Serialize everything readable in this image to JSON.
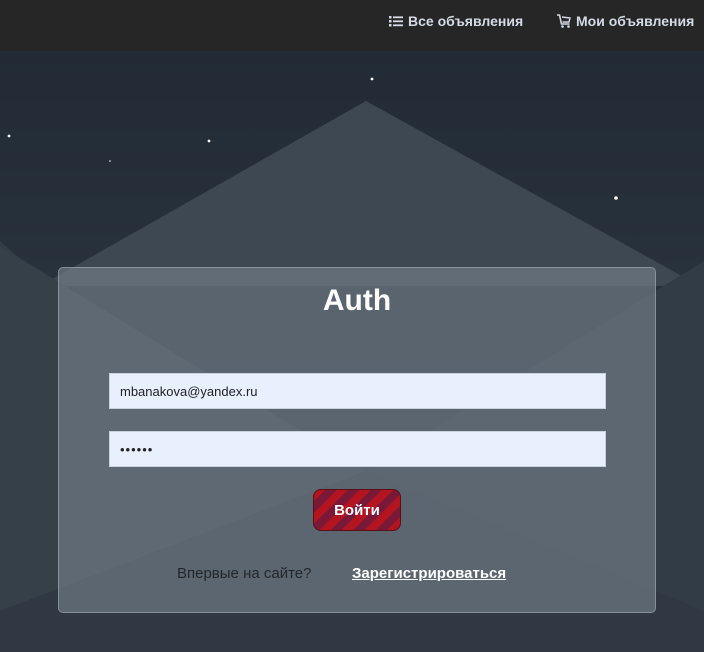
{
  "nav": {
    "all_ads": {
      "label": "Все объявления",
      "icon": "list-icon"
    },
    "my_ads": {
      "label": "Мои объявления",
      "icon": "cart-icon"
    }
  },
  "auth": {
    "title": "Auth",
    "email_value": "mbanakova@yandex.ru",
    "password_value": "••••••",
    "submit_label": "Войти",
    "signup_prompt": "Впервые на сайте?",
    "signup_link": "Зарегистрироваться"
  },
  "colors": {
    "topbar": "#262626",
    "background": "#27313b",
    "button": "#b3141f",
    "input": "#e8f0fe"
  }
}
